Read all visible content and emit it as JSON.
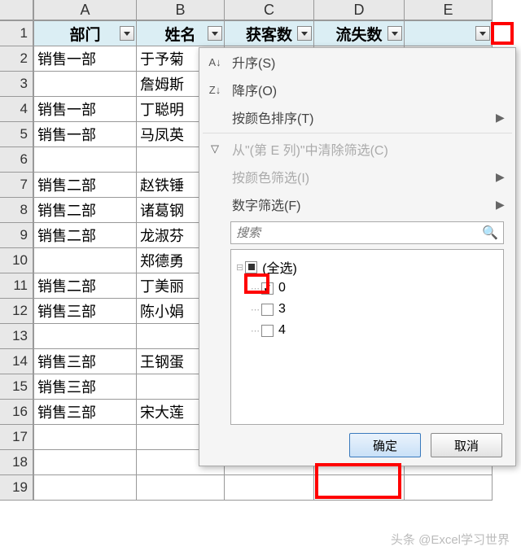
{
  "cols": [
    "A",
    "B",
    "C",
    "D",
    "E"
  ],
  "headers": {
    "A": "部门",
    "B": "姓名",
    "C": "获客数",
    "D": "流失数",
    "E": ""
  },
  "rows": [
    {
      "n": "1"
    },
    {
      "n": "2",
      "A": "销售一部",
      "B": "于予菊"
    },
    {
      "n": "3",
      "A": "",
      "B": "詹姆斯"
    },
    {
      "n": "4",
      "A": "销售一部",
      "B": "丁聪明"
    },
    {
      "n": "5",
      "A": "销售一部",
      "B": "马凤英"
    },
    {
      "n": "6",
      "A": "",
      "B": ""
    },
    {
      "n": "7",
      "A": "销售二部",
      "B": "赵铁锤"
    },
    {
      "n": "8",
      "A": "销售二部",
      "B": "诸葛钢"
    },
    {
      "n": "9",
      "A": "销售二部",
      "B": "龙淑芬"
    },
    {
      "n": "10",
      "A": "",
      "B": "郑德勇"
    },
    {
      "n": "11",
      "A": "销售二部",
      "B": "丁美丽"
    },
    {
      "n": "12",
      "A": "销售三部",
      "B": "陈小娟"
    },
    {
      "n": "13",
      "A": "",
      "B": ""
    },
    {
      "n": "14",
      "A": "销售三部",
      "B": "王钢蛋"
    },
    {
      "n": "15",
      "A": "销售三部",
      "B": ""
    },
    {
      "n": "16",
      "A": "销售三部",
      "B": "宋大莲"
    },
    {
      "n": "17",
      "A": "",
      "B": ""
    },
    {
      "n": "18",
      "A": "",
      "B": ""
    },
    {
      "n": "19",
      "A": "",
      "B": ""
    }
  ],
  "menu": {
    "asc": "升序(S)",
    "desc": "降序(O)",
    "sortcolor": "按颜色排序(T)",
    "clear": "从\"(第 E 列)\"中清除筛选(C)",
    "filtercolor": "按颜色筛选(I)",
    "numfilter": "数字筛选(F)",
    "search_ph": "搜索",
    "selectall": "(全选)",
    "opt0": "0",
    "opt3": "3",
    "opt4": "4",
    "ok": "确定",
    "cancel": "取消"
  },
  "watermark": "头条 @Excel学习世界"
}
